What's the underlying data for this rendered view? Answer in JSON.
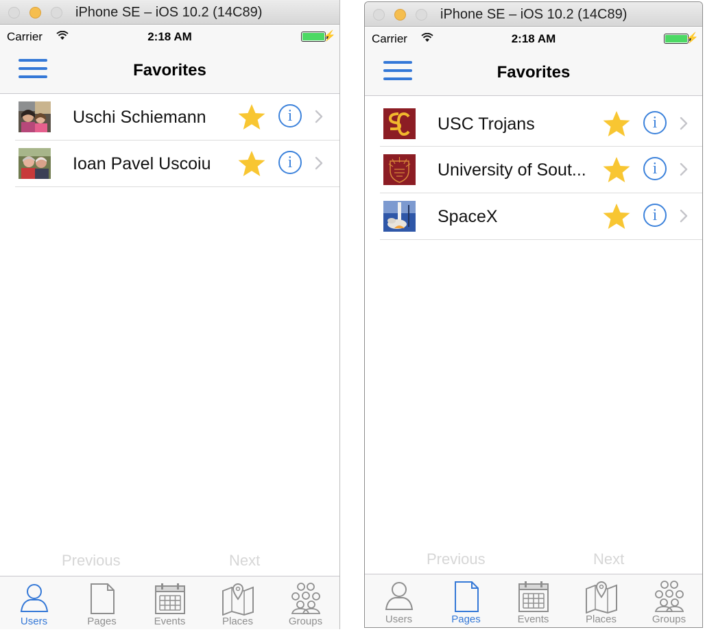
{
  "screens": [
    {
      "window_title": "iPhone SE – iOS 10.2 (14C89)",
      "status": {
        "carrier": "Carrier",
        "time": "2:18 AM"
      },
      "nav_title": "Favorites",
      "rows": [
        {
          "name": "Uschi Schiemann",
          "thumb": "person-photo"
        },
        {
          "name": "Ioan Pavel Uscoiu",
          "thumb": "person-photo"
        }
      ],
      "pager": {
        "previous": "Previous",
        "next": "Next"
      },
      "tabs": [
        {
          "label": "Users",
          "icon": "user-icon"
        },
        {
          "label": "Pages",
          "icon": "page-icon"
        },
        {
          "label": "Events",
          "icon": "calendar-icon"
        },
        {
          "label": "Places",
          "icon": "map-icon"
        },
        {
          "label": "Groups",
          "icon": "group-icon"
        }
      ],
      "active_tab": "Users"
    },
    {
      "window_title": "iPhone SE – iOS 10.2 (14C89)",
      "status": {
        "carrier": "Carrier",
        "time": "2:18 AM"
      },
      "nav_title": "Favorites",
      "rows": [
        {
          "name": "USC Trojans",
          "thumb": "sc-logo"
        },
        {
          "name": "University of Sout...",
          "thumb": "usc-seal"
        },
        {
          "name": "SpaceX",
          "thumb": "rocket-photo"
        }
      ],
      "pager": {
        "previous": "Previous",
        "next": "Next"
      },
      "tabs": [
        {
          "label": "Users",
          "icon": "user-icon"
        },
        {
          "label": "Pages",
          "icon": "page-icon"
        },
        {
          "label": "Events",
          "icon": "calendar-icon"
        },
        {
          "label": "Places",
          "icon": "map-icon"
        },
        {
          "label": "Groups",
          "icon": "group-icon"
        }
      ],
      "active_tab": "Pages"
    }
  ],
  "colors": {
    "accent": "#3478d7",
    "star": "#f8c632",
    "inactive_tab": "#8e8e8e",
    "pager_text": "#d6d6d6",
    "usc_cardinal": "#8c1d24",
    "usc_gold": "#f1b82d"
  }
}
